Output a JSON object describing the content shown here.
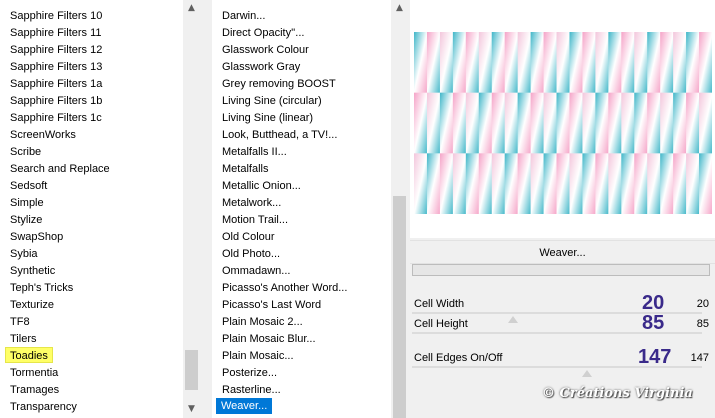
{
  "left_list": {
    "items": [
      "Sapphire Filters 10",
      "Sapphire Filters 11",
      "Sapphire Filters 12",
      "Sapphire Filters 13",
      "Sapphire Filters 1a",
      "Sapphire Filters 1b",
      "Sapphire Filters 1c",
      "ScreenWorks",
      "Scribe",
      "Search and Replace",
      "Sedsoft",
      "Simple",
      "Stylize",
      "SwapShop",
      "Sybia",
      "Synthetic",
      "Teph's Tricks",
      "Texturize",
      "TF8",
      "Tilers",
      "Toadies",
      "Tormentia",
      "Tramages",
      "Transparency"
    ],
    "highlighted": "Toadies"
  },
  "mid_list": {
    "items": [
      "Darwin...",
      "Direct Opacity''...",
      "Glasswork Colour",
      "Glasswork Gray",
      "Grey removing BOOST",
      "Living Sine (circular)",
      "Living Sine (linear)",
      "Look, Butthead, a TV!...",
      "Metalfalls II...",
      "Metalfalls",
      "Metallic Onion...",
      "Metalwork...",
      "Motion Trail...",
      "Old Colour",
      "Old Photo...",
      "Ommadawn...",
      "Picasso's Another Word...",
      "Picasso's Last Word",
      "Plain Mosaic 2...",
      "Plain Mosaic Blur...",
      "Plain Mosaic...",
      "Posterize...",
      "Rasterline...",
      "Weaver..."
    ],
    "selected": "Weaver..."
  },
  "dialog": {
    "title": "Weaver...",
    "params": [
      {
        "label": "Cell Width",
        "big": "20",
        "value": "20"
      },
      {
        "label": "Cell Height",
        "big": "85",
        "value": "85"
      },
      {
        "label": "Cell Edges On/Off",
        "big": "147",
        "value": "147"
      }
    ]
  },
  "icons": {
    "up": "chevron-up-icon",
    "down": "chevron-down-icon"
  },
  "colors": {
    "selection": "#0078d7",
    "highlight": "#ffff66",
    "param_big": "#3a2a8a",
    "teal": "#3fb6c8",
    "pink": "#f5a3c7"
  },
  "watermark": "© Créations Virginia"
}
